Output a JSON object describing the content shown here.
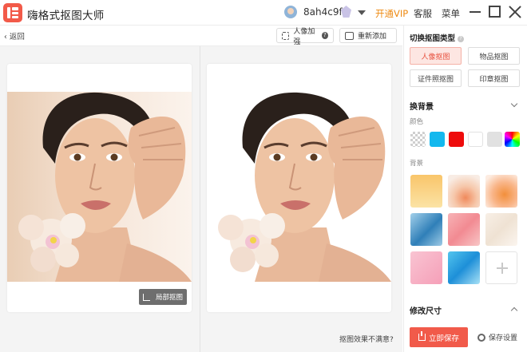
{
  "app": {
    "title": "嗨格式抠图大师",
    "brand_color": "#f25a49"
  },
  "account": {
    "username": "8ah4c9f",
    "vip_label": "开通VIP",
    "service_label": "客服",
    "menu_label": "菜单"
  },
  "toolbar": {
    "back_label": "返回",
    "portrait_enhance_label": "人像加强",
    "portrait_help_glyph": "?",
    "readd_label": "重新添加"
  },
  "canvas": {
    "local_cutout_label": "局部抠图",
    "unsatisfied_label": "抠图效果不满意?"
  },
  "panel": {
    "cutout_type_title": "切换抠图类型",
    "help_glyph": "?",
    "cutout_types": [
      {
        "label": "人像抠图",
        "active": true
      },
      {
        "label": "物品抠图",
        "active": false
      },
      {
        "label": "证件照抠图",
        "active": false
      },
      {
        "label": "印章抠图",
        "active": false
      }
    ],
    "background_section_title": "换背景",
    "color_label": "颜色",
    "colors": [
      {
        "name": "transparent",
        "hex": "transparent"
      },
      {
        "name": "cyan",
        "hex": "#13b8ee"
      },
      {
        "name": "red",
        "hex": "#ee0c0c"
      },
      {
        "name": "white",
        "hex": "#ffffff"
      },
      {
        "name": "gray",
        "hex": "#e1e1e1"
      },
      {
        "name": "custom-rainbow",
        "hex": "rainbow"
      }
    ],
    "background_label": "背景",
    "resize_section_title": "修改尺寸",
    "save_label": "立即保存",
    "save_settings_label": "保存设置"
  }
}
